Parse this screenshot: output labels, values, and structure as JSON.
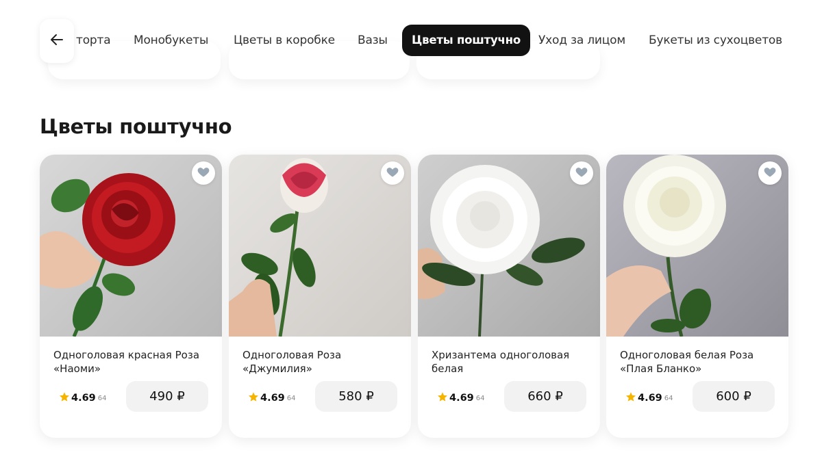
{
  "categories": {
    "items": [
      {
        "label": "торта"
      },
      {
        "label": "Монобукеты"
      },
      {
        "label": "Цветы в коробке"
      },
      {
        "label": "Вазы"
      },
      {
        "label": "Цветы поштучно",
        "active": true
      },
      {
        "label": "Уход за лицом"
      },
      {
        "label": "Букеты из сухоцветов"
      }
    ]
  },
  "section": {
    "title": "Цветы поштучно"
  },
  "products": [
    {
      "name_line1": "Одноголовая красная Роза",
      "name_line2": "«Наоми»",
      "rating": "4.69",
      "reviews": "64",
      "price": "490 ₽"
    },
    {
      "name_line1": "Одноголовая Роза",
      "name_line2": "«Джумилия»",
      "rating": "4.69",
      "reviews": "64",
      "price": "580 ₽"
    },
    {
      "name_line1": "Хризантема одноголовая",
      "name_line2": "белая",
      "rating": "4.69",
      "reviews": "64",
      "price": "660 ₽"
    },
    {
      "name_line1": "Одноголовая белая Роза",
      "name_line2": "«Плая Бланко»",
      "rating": "4.69",
      "reviews": "64",
      "price": "600 ₽"
    }
  ],
  "colors": {
    "accent": "#121212",
    "star": "#f5b400",
    "heart": "#9aa7b4",
    "price_bg": "#f2f2f2"
  },
  "icons": {
    "back": "arrow-left-icon",
    "favorite": "heart-icon",
    "rating": "star-icon"
  }
}
